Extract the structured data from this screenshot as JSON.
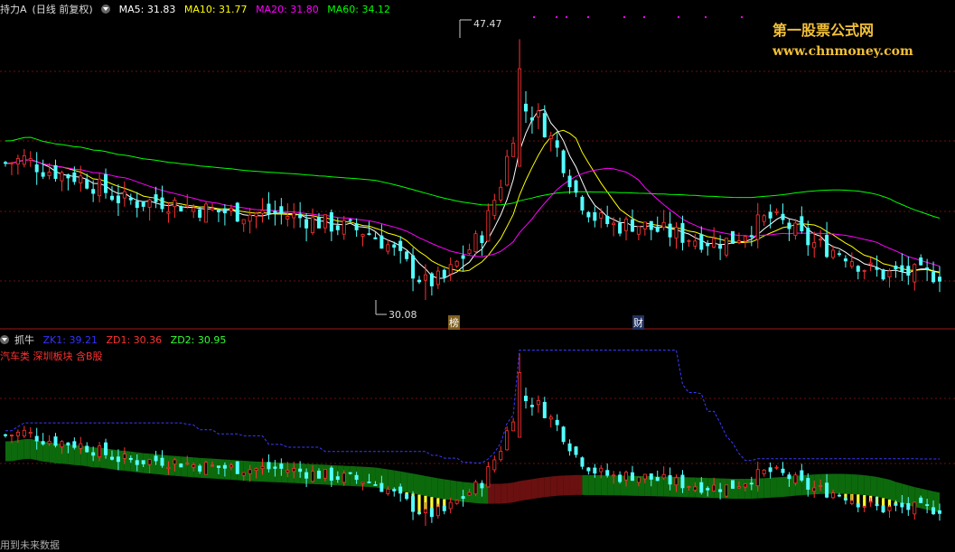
{
  "main_legend": {
    "stock_name": "持力A",
    "period": "(日线 前复权)",
    "ma5": "MA5: 31.83",
    "ma10": "MA10: 31.77",
    "ma20": "MA20: 31.80",
    "ma60": "MA60: 34.12"
  },
  "sub_legend": {
    "indicator": "抓牛",
    "zk1": "ZK1: 39.21",
    "zd1": "ZD1: 30.36",
    "zd2": "ZD2: 30.95",
    "sector": "汽车类 深圳板块 含B股"
  },
  "annotations": {
    "high": "47.47",
    "low": "30.08",
    "marker1": "榜",
    "marker2": "财"
  },
  "watermark": {
    "name": "第一股票公式网",
    "url": "www.chnmoney.com"
  },
  "bottom_text": "用到未来数据",
  "colors": {
    "up": "#ff3232",
    "down": "#54ffff",
    "ma5": "#ffffff",
    "ma10": "#ffff00",
    "ma20": "#ff00ff",
    "ma60": "#00ff00",
    "watermark": "#f2c037"
  },
  "chart_data": {
    "type": "candlestick",
    "ylim": [
      29,
      49
    ],
    "highest": 47.47,
    "lowest": 30.08,
    "close_path": [
      39.2,
      39.5,
      38.8,
      38.5,
      38.2,
      37.5,
      36.8,
      36.6,
      36.7,
      36.5,
      36.2,
      36.0,
      35.9,
      35.8,
      35.9,
      35.7,
      35.4,
      35.1,
      34.9,
      34.6,
      33.8,
      32.5,
      31.2,
      31.5,
      33.0,
      34.5,
      38.0,
      43.0,
      42.2,
      40.0,
      37.0,
      35.5,
      35.0,
      35.2,
      34.8,
      34.5,
      34.2,
      34.0,
      34.0,
      34.8,
      35.6,
      35.1,
      34.0,
      33.6,
      33.2,
      32.3,
      31.8,
      31.9,
      31.8,
      31.83
    ],
    "series": [
      {
        "name": "MA5",
        "last": 31.83
      },
      {
        "name": "MA10",
        "last": 31.77
      },
      {
        "name": "MA20",
        "last": 31.8
      },
      {
        "name": "MA60",
        "last": 34.12
      }
    ],
    "indicator": {
      "name": "抓牛",
      "ZK1": 39.21,
      "ZD1": 30.36,
      "ZD2": 30.95
    }
  }
}
